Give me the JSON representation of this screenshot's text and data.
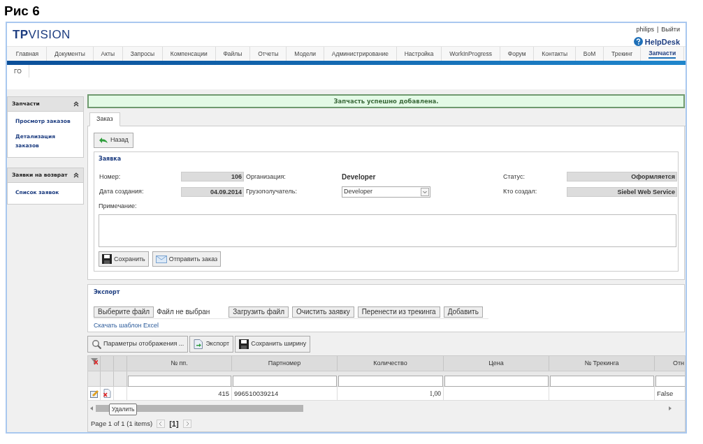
{
  "caption": "Рис 6",
  "logo": "**TP**VISION",
  "user": "philips",
  "separator": "|",
  "logout": "Выйти",
  "helpdesk": "HelpDesk",
  "nav": [
    {
      "label": "Главная",
      "selected": false
    },
    {
      "label": "Документы",
      "selected": false
    },
    {
      "label": "Акты",
      "selected": false
    },
    {
      "label": "Запросы",
      "selected": false
    },
    {
      "label": "Компенсации",
      "selected": false
    },
    {
      "label": "Файлы",
      "selected": false
    },
    {
      "label": "Отчеты",
      "selected": false
    },
    {
      "label": "Модели",
      "selected": false
    },
    {
      "label": "Администрирование",
      "selected": false
    },
    {
      "label": "Настройка",
      "selected": false
    },
    {
      "label": "WorkInProgress",
      "selected": false
    },
    {
      "label": "Форум",
      "selected": false
    },
    {
      "label": "Контакты",
      "selected": false
    },
    {
      "label": "BoM",
      "selected": false
    },
    {
      "label": "Трекинг",
      "selected": false
    },
    {
      "label": "Запчасти",
      "selected": true
    }
  ],
  "subnav": [
    "ГО"
  ],
  "sidebar": [
    {
      "title": "Запчасти",
      "expanded": true,
      "items": [
        "Просмотр заказов",
        "Детализация заказов"
      ]
    },
    {
      "title": "Заявки на возврат",
      "expanded": true,
      "items": [
        "Список заявок"
      ]
    }
  ],
  "message": "Запчасть успешно добавлена.",
  "tabs": [
    {
      "label": "Заказ",
      "selected": true
    }
  ],
  "back_button": "Назад",
  "request": {
    "title": "Заявка",
    "number": {
      "label": "Номер:",
      "value": "106"
    },
    "created": {
      "label": "Дата создания:",
      "value": "04.09.2014"
    },
    "organization": {
      "label": "Организация:",
      "value": "Developer"
    },
    "consignee": {
      "label": "Грузополучатель:",
      "value": "Developer"
    },
    "status": {
      "label": "Статус:",
      "value": "Оформляется"
    },
    "author": {
      "label": "Кто создал:",
      "value": "Siebel Web Service"
    },
    "note": {
      "label": "Примечание:"
    },
    "buttons": [
      {
        "kind": "save",
        "label": "Сохранить"
      },
      {
        "kind": "send",
        "label": "Отправить заказ"
      }
    ]
  },
  "export": {
    "title": "Экспорт",
    "file_button": "Выберите файл",
    "file_status": "Файл не выбран",
    "buttons": [
      "Загрузить файл",
      "Очистить заявку",
      "Перенести из трекинга",
      "Добавить"
    ],
    "template_link": "Скачать шаблон Excel"
  },
  "toolbar": [
    {
      "kind": "search",
      "label": "Параметры отображения ..."
    },
    {
      "kind": "export",
      "label": "Экспорт"
    },
    {
      "kind": "save",
      "label": "Сохранить ширину"
    }
  ],
  "table": {
    "columns": [
      "№ пп.",
      "Партномер",
      "Количество",
      "Цена",
      "№ Трекинга",
      "Отн"
    ],
    "rows": [
      [
        "415",
        "996510039214",
        "1,00",
        "",
        "",
        "False"
      ]
    ]
  },
  "tooltip": "Удалить",
  "pager": {
    "summary": "Page 1 of 1 (1 items)",
    "pages": [
      {
        "label": "[1]",
        "selected": true
      }
    ]
  }
}
